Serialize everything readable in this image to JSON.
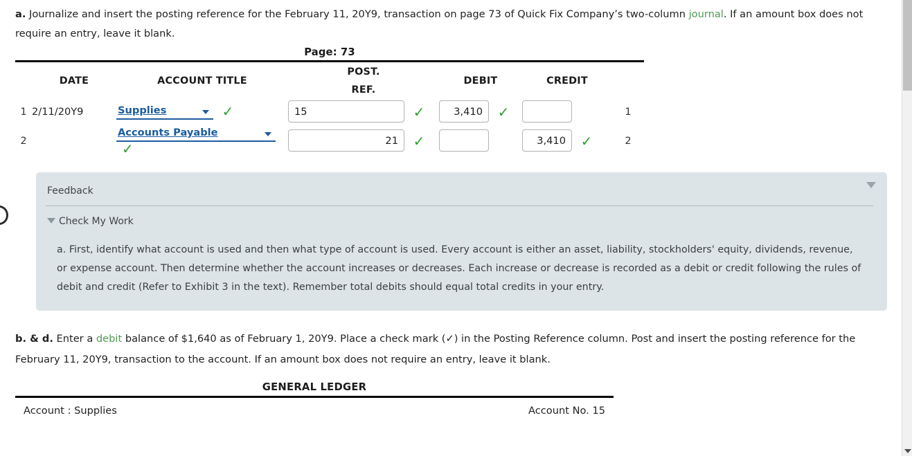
{
  "question_a": {
    "label": "a.",
    "line1_before": " Journalize and insert the posting reference for the February 11, 20Y9, transaction on page 73 of Quick Fix Company’s two-column ",
    "term": "journal",
    "line1_after": ". If an amount box does not require an entry, leave it blank."
  },
  "journal": {
    "page_label": "Page: 73",
    "headers": {
      "date": "DATE",
      "account_title": "ACCOUNT TITLE",
      "post_ref_line1": "POST.",
      "post_ref_line2": "REF.",
      "debit": "DEBIT",
      "credit": "CREDIT"
    },
    "rows": [
      {
        "num": "1",
        "num_right": "1",
        "date": "2/11/20Y9",
        "account": "Supplies",
        "account_checked": "✓",
        "post_ref": "15",
        "post_ref_checked": "✓",
        "debit": "3,410",
        "debit_checked": "✓",
        "credit": "",
        "credit_checked": ""
      },
      {
        "num": "2",
        "num_right": "2",
        "date": "",
        "account": "Accounts Payable",
        "account_checked": "✓",
        "post_ref": "21",
        "post_ref_checked": "✓",
        "debit": "",
        "debit_checked": "",
        "credit": "3,410",
        "credit_checked": "✓"
      }
    ],
    "account_options": [
      "Supplies",
      "Accounts Payable"
    ]
  },
  "feedback": {
    "title": "Feedback",
    "check_my_work": "Check My Work",
    "body": "a. First, identify what account is used and then what type of account is used. Every account is either an asset, liability, stockholders' equity, dividends, revenue, or expense account. Then determine whether the account increases or decreases. Each increase or decrease is recorded as a debit or credit following the rules of debit and credit (Refer to Exhibit 3 in the text). Remember total debits should equal total credits in your entry."
  },
  "question_bd": {
    "label": "b. & d.",
    "before": " Enter a ",
    "term": "debit",
    "after": " balance of $1,640 as of February 1, 20Y9. Place a check mark (✓) in the Posting Reference column. Post and insert the posting reference for the February 11, 20Y9, transaction to the account. If an amount box does not require an entry, leave it blank."
  },
  "general_ledger": {
    "title": "GENERAL LEDGER",
    "account_label": "Account : Supplies",
    "account_no": "Account No. 15"
  },
  "colors": {
    "term_green": "#4f9a53",
    "check_green": "#2e9e2e",
    "select_blue": "#1a5ca0",
    "feedback_bg": "#dde4e7"
  }
}
